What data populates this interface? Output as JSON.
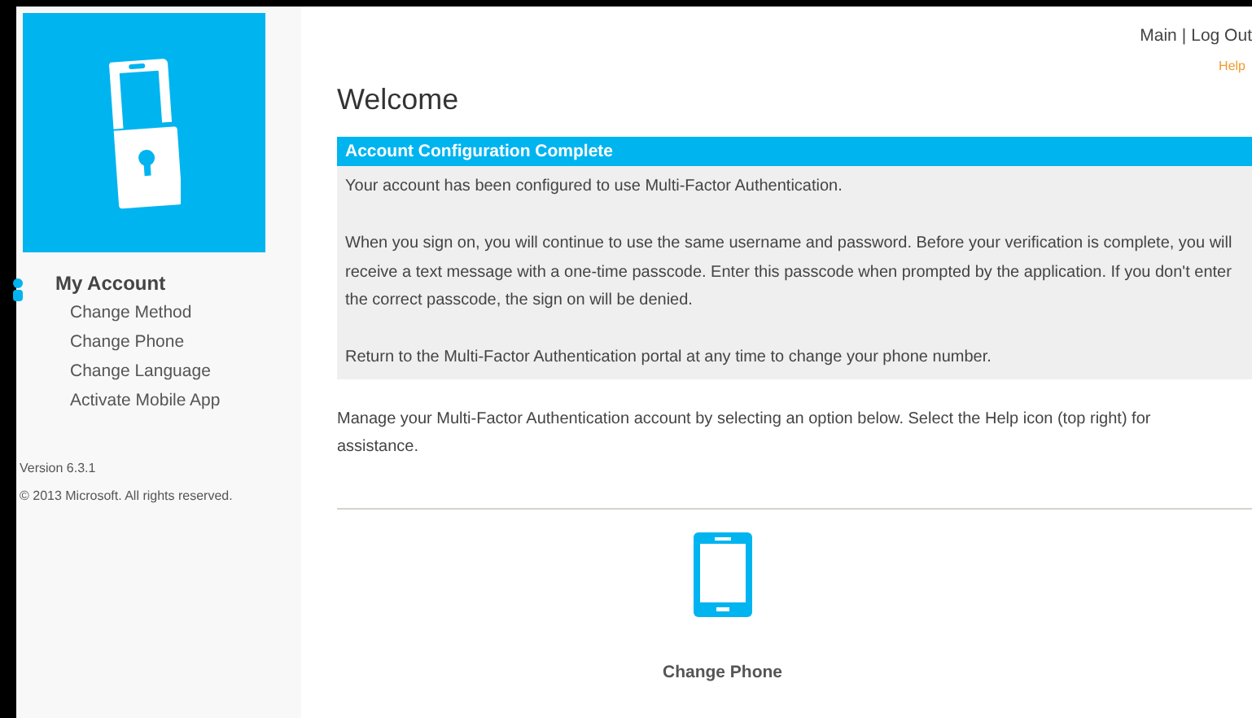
{
  "sidebar": {
    "heading": "My Account",
    "items": [
      "Change Method",
      "Change Phone",
      "Change Language",
      "Activate Mobile App"
    ],
    "version": "Version 6.3.1",
    "copyright": "© 2013 Microsoft. All rights reserved."
  },
  "top_links": [
    "Main",
    "Log Out"
  ],
  "link_separator": "|",
  "help_link": "Help",
  "title": "Welcome",
  "panel": {
    "title": "Account Configuration Complete",
    "paragraphs": [
      "Your account has been configured to use Multi-Factor Authentication.",
      "When you sign on, you will continue to use the same username and password. Before your verification is complete, you will receive a text message with a one-time passcode. Enter this passcode when prompted by the application. If you don't enter the correct passcode, the sign on will be denied.",
      "Return to the Multi-Factor Authentication portal at any time to change your phone number."
    ]
  },
  "instructions": "Manage your Multi-Factor Authentication account by selecting an option below. Select the Help icon (top right) for assistance.",
  "options": [
    {
      "label": "Change Phone"
    }
  ]
}
